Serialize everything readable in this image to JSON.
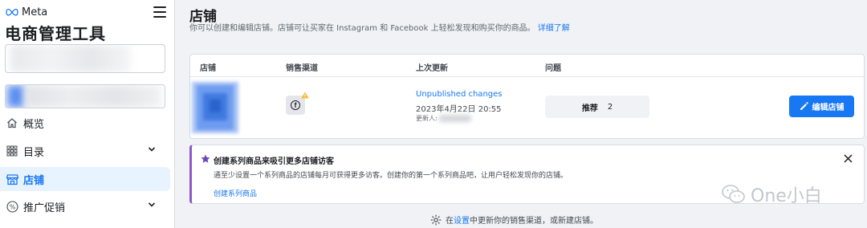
{
  "sidebar": {
    "brand": "Meta",
    "title": "电商管理工具",
    "nav": [
      {
        "label": "概览",
        "icon": "home-icon",
        "active": false,
        "expandable": false
      },
      {
        "label": "目录",
        "icon": "grid-icon",
        "active": false,
        "expandable": true
      },
      {
        "label": "店铺",
        "icon": "storefront-icon",
        "active": true,
        "expandable": false
      },
      {
        "label": "推广促销",
        "icon": "percent-icon",
        "active": false,
        "expandable": true
      }
    ]
  },
  "main": {
    "title": "店铺",
    "description": "你可以创建和编辑店铺。店铺可让买家在 Instagram 和 Facebook 上轻松发现和购买你的商品。",
    "learn_more": "详细了解",
    "table": {
      "headers": {
        "store": "店铺",
        "channel": "销售渠道",
        "last_update": "上次更新",
        "issues": "问题"
      },
      "row": {
        "status_link": "Unpublished changes",
        "date": "2023年4月22日 20:55",
        "updated_by": "更新人:",
        "issue_label": "推荐",
        "issue_count": "2",
        "edit_button": "编辑店铺"
      }
    },
    "notice": {
      "title": "创建系列商品来吸引更多店铺访客",
      "body": "通至少设置一个系列商品的店铺每月可获得更多访客。创建你的第一个系列商品吧，让用户轻松发现你的店铺。",
      "link": "创建系列商品"
    },
    "footer": {
      "prefix": "在",
      "link": "设置",
      "suffix": "中更新你的销售渠道，或新建店铺。"
    }
  },
  "watermark": "One小白",
  "colors": {
    "accent": "#1877f2",
    "active_bg": "#e7f3ff",
    "notice_border": "#8c5ac8",
    "warning": "#f7b928"
  }
}
